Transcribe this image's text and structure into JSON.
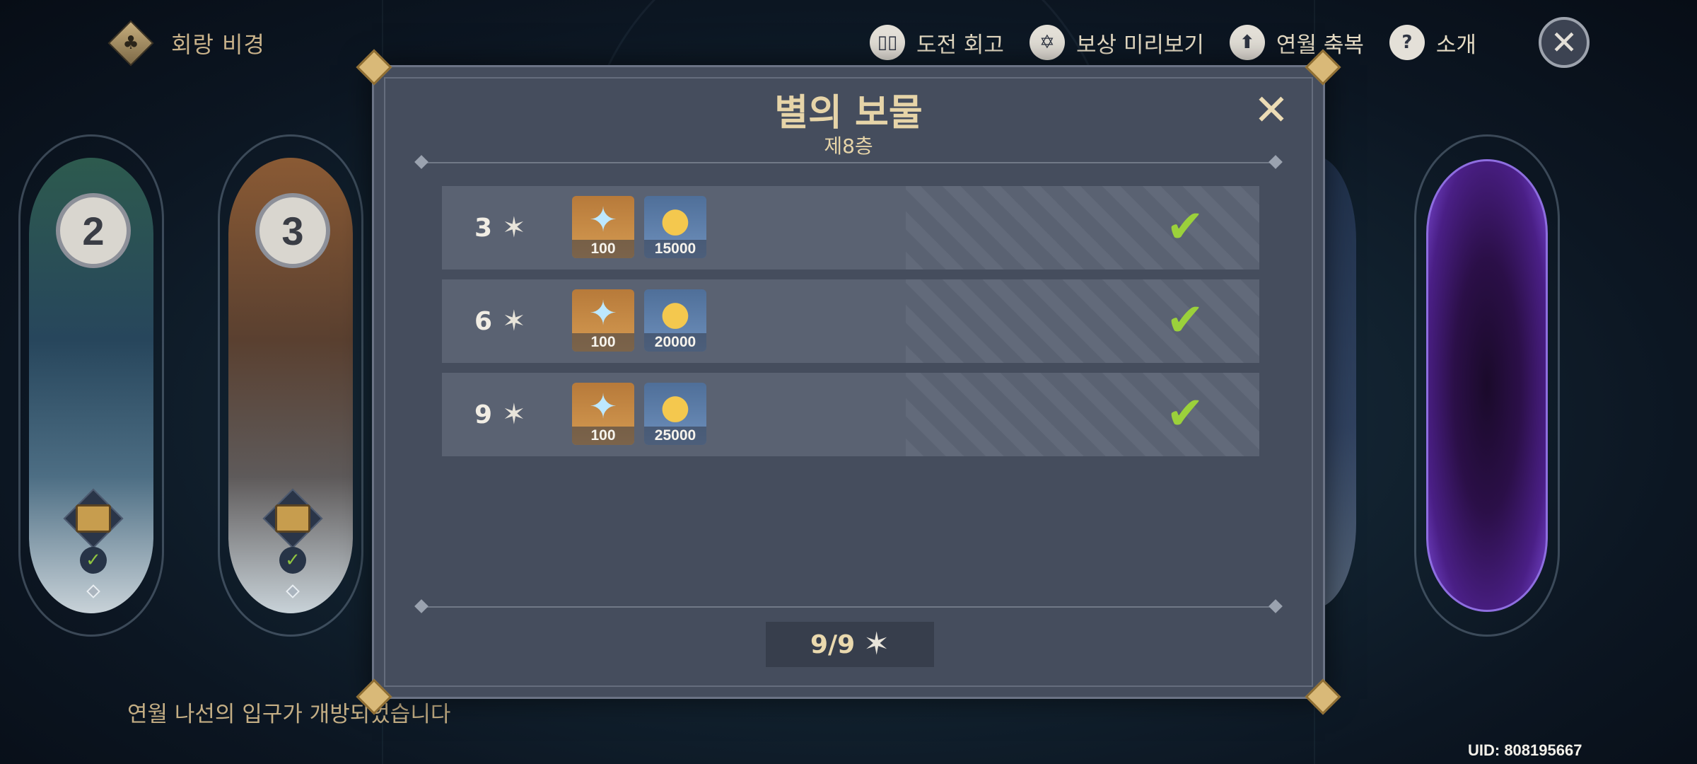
{
  "header": {
    "mode_title": "회랑 비경",
    "nav": [
      {
        "label": "도전 회고",
        "icon": "book-icon"
      },
      {
        "label": "보상 미리보기",
        "icon": "star-badge-icon"
      },
      {
        "label": "연월 축복",
        "icon": "blessing-up-icon"
      },
      {
        "label": "소개",
        "icon": "help-icon"
      }
    ],
    "close_icon": "close-icon"
  },
  "chambers": [
    {
      "number": "2",
      "cleared": true
    },
    {
      "number": "3",
      "cleared": true
    }
  ],
  "modal": {
    "title": "별의 보물",
    "subtitle": "제8층",
    "rows": [
      {
        "stars": "3",
        "rewards": [
          {
            "name": "primogem",
            "count": "100"
          },
          {
            "name": "mora",
            "count": "15000"
          }
        ],
        "claimed": true
      },
      {
        "stars": "6",
        "rewards": [
          {
            "name": "primogem",
            "count": "100"
          },
          {
            "name": "mora",
            "count": "20000"
          }
        ],
        "claimed": true
      },
      {
        "stars": "9",
        "rewards": [
          {
            "name": "primogem",
            "count": "100"
          },
          {
            "name": "mora",
            "count": "25000"
          }
        ],
        "claimed": true
      }
    ],
    "total": "9/9"
  },
  "footer": {
    "message": "연월 나선의 입구가 개방되었습니다",
    "uid": "UID: 808195667"
  },
  "colors": {
    "accent_gold": "#e6d4a8",
    "check_green": "#9bd13b",
    "modal_bg": "#454d5d"
  }
}
